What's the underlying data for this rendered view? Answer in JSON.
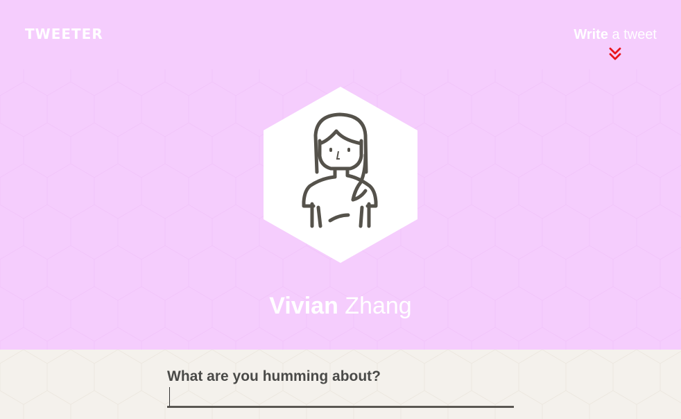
{
  "header": {
    "logo": "TWEETER",
    "write_link": {
      "strong": "Write",
      "light": " a tweet"
    },
    "background_color": "#f5cdfd",
    "accent_color": "#e8151b"
  },
  "profile": {
    "first_name": "Vivian",
    "last_name": "Zhang",
    "avatar_icon": "woman-avatar-icon"
  },
  "compose": {
    "label": "What are you humming about?",
    "input_value": "",
    "input_placeholder": ""
  }
}
